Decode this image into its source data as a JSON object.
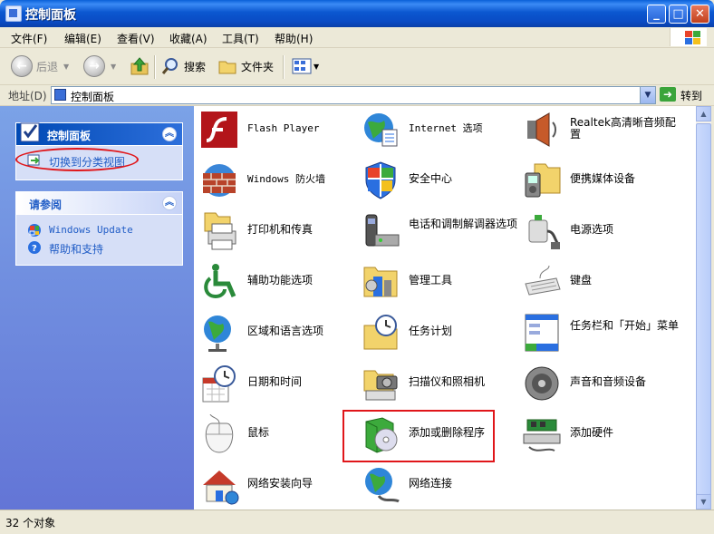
{
  "window": {
    "title": "控制面板"
  },
  "menu": [
    "文件(F)",
    "编辑(E)",
    "查看(V)",
    "收藏(A)",
    "工具(T)",
    "帮助(H)"
  ],
  "toolbar": {
    "back": "后退",
    "search": "搜索",
    "folders": "文件夹"
  },
  "address": {
    "label": "地址(D)",
    "value": "控制面板",
    "go": "转到"
  },
  "left": {
    "panel1": {
      "title": "控制面板",
      "link": "切换到分类视图"
    },
    "panel2": {
      "title": "请参阅",
      "links": [
        "Windows Update",
        "帮助和支持"
      ]
    }
  },
  "items": [
    {
      "label": "Flash Player",
      "icon": "flash-player-icon"
    },
    {
      "label": "Internet 选项",
      "icon": "internet-options-icon"
    },
    {
      "label": "Realtek高清晰音频配置",
      "icon": "realtek-audio-icon"
    },
    {
      "label": "Windows 防火墙",
      "icon": "firewall-icon"
    },
    {
      "label": "安全中心",
      "icon": "security-center-icon"
    },
    {
      "label": "便携媒体设备",
      "icon": "portable-media-icon"
    },
    {
      "label": "打印机和传真",
      "icon": "printer-fax-icon"
    },
    {
      "label": "电话和调制解调器选项",
      "icon": "phone-modem-icon"
    },
    {
      "label": "电源选项",
      "icon": "power-options-icon"
    },
    {
      "label": "辅助功能选项",
      "icon": "accessibility-icon"
    },
    {
      "label": "管理工具",
      "icon": "admin-tools-icon"
    },
    {
      "label": "键盘",
      "icon": "keyboard-icon"
    },
    {
      "label": "区域和语言选项",
      "icon": "region-language-icon"
    },
    {
      "label": "任务计划",
      "icon": "scheduled-tasks-icon"
    },
    {
      "label": "任务栏和「开始」菜单",
      "icon": "taskbar-start-icon"
    },
    {
      "label": "日期和时间",
      "icon": "date-time-icon"
    },
    {
      "label": "扫描仪和照相机",
      "icon": "scanner-camera-icon"
    },
    {
      "label": "声音和音频设备",
      "icon": "sound-audio-icon"
    },
    {
      "label": "鼠标",
      "icon": "mouse-icon"
    },
    {
      "label": "添加或删除程序",
      "icon": "add-remove-programs-icon"
    },
    {
      "label": "添加硬件",
      "icon": "add-hardware-icon"
    },
    {
      "label": "网络安装向导",
      "icon": "network-setup-icon"
    },
    {
      "label": "网络连接",
      "icon": "network-connections-icon"
    }
  ],
  "status": {
    "text": "32 个对象"
  },
  "colors": {
    "accent": "#0a4bc4",
    "highlight": "#e0161a",
    "pane": "#7ba2e7"
  }
}
